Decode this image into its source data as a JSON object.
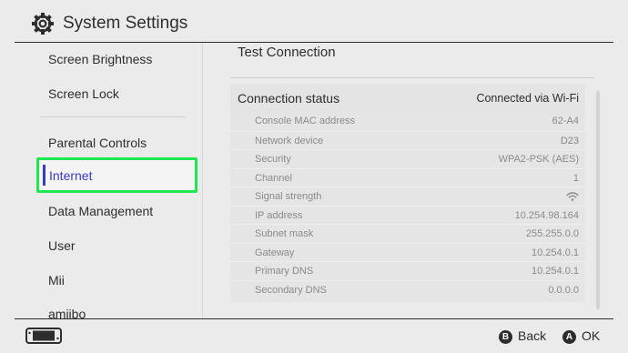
{
  "header": {
    "title": "System Settings",
    "icon": "gear-icon"
  },
  "sidebar": {
    "items": [
      {
        "label": "Screen Brightness"
      },
      {
        "label": "Screen Lock"
      },
      {
        "label": "Parental Controls"
      },
      {
        "label": "Internet",
        "selected": true
      },
      {
        "label": "Data Management"
      },
      {
        "label": "User"
      },
      {
        "label": "Mii"
      },
      {
        "label": "amiibo"
      }
    ],
    "selection_color": "#1de84f",
    "selected_text_color": "#3a3ac4"
  },
  "content": {
    "title": "Test Connection",
    "connection_status": {
      "label": "Connection status",
      "value": "Connected via Wi-Fi"
    },
    "details": [
      {
        "label": "Console MAC address",
        "value": "62-A4"
      },
      {
        "label": "Network device",
        "value": "D23"
      },
      {
        "label": "Security",
        "value": "WPA2-PSK (AES)"
      },
      {
        "label": "Channel",
        "value": "1"
      },
      {
        "label": "Signal strength",
        "value": "",
        "icon": "wifi-icon"
      },
      {
        "label": "IP address",
        "value": "10.254.98.164"
      },
      {
        "label": "Subnet mask",
        "value": "255.255.0.0"
      },
      {
        "label": "Gateway",
        "value": "10.254.0.1"
      },
      {
        "label": "Primary DNS",
        "value": "10.254.0.1"
      },
      {
        "label": "Secondary DNS",
        "value": "0.0.0.0"
      }
    ]
  },
  "footer": {
    "console_icon": "switch-console-icon",
    "back": {
      "button": "B",
      "label": "Back"
    },
    "ok": {
      "button": "A",
      "label": "OK"
    }
  }
}
